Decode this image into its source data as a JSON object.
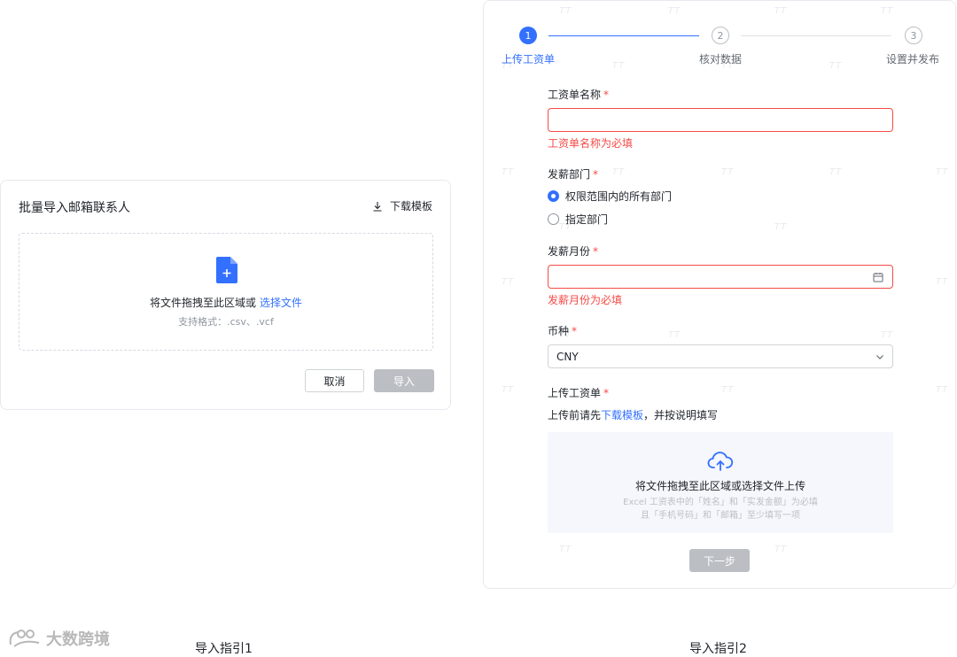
{
  "guide1": {
    "title": "批量导入邮箱联系人",
    "download_template": "下载模板",
    "drop_text": "将文件拖拽至此区域或",
    "select_file_link": "选择文件",
    "formats": "支持格式：.csv、.vcf",
    "cancel_label": "取消",
    "import_label": "导入",
    "caption": "导入指引1"
  },
  "guide2": {
    "steps": [
      {
        "num": "1",
        "label": "上传工资单",
        "state": "active"
      },
      {
        "num": "2",
        "label": "核对数据",
        "state": "pending"
      },
      {
        "num": "3",
        "label": "设置并发布",
        "state": "pending"
      }
    ],
    "payroll_name": {
      "label": "工资单名称",
      "required": "*",
      "value": "",
      "error": "工资单名称为必填"
    },
    "department": {
      "label": "发薪部门",
      "required": "*",
      "options": [
        {
          "label": "权限范围内的所有部门",
          "selected": true
        },
        {
          "label": "指定部门",
          "selected": false
        }
      ]
    },
    "pay_month": {
      "label": "发薪月份",
      "required": "*",
      "value": "",
      "error": "发薪月份为必填"
    },
    "currency": {
      "label": "币种",
      "required": "*",
      "value": "CNY"
    },
    "upload": {
      "label": "上传工资单",
      "required": "*",
      "hint_prefix": "上传前请先",
      "hint_link": "下载模板",
      "hint_suffix": "，并按说明填写",
      "drop_text": "将文件拖拽至此区域或选择文件上传",
      "note_line1": "Excel 工资表中的「姓名」和「实发金额」为必填",
      "note_line2": "且「手机号码」和「邮箱」至少填写一项"
    },
    "next_label": "下一步",
    "caption": "导入指引2"
  },
  "watermark": "TT",
  "logo_text": "大数跨境",
  "colors": {
    "primary": "#3370ff",
    "error": "#f54a45",
    "disabled": "#bbbfc4",
    "text": "#1f2329",
    "muted": "#8f959e"
  }
}
